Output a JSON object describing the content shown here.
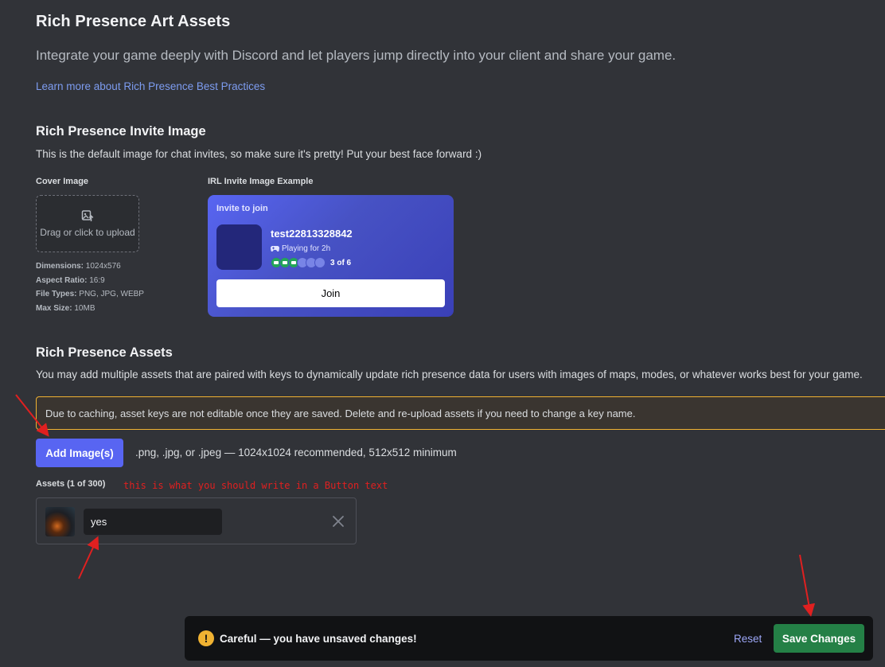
{
  "header": {
    "title": "Rich Presence Art Assets",
    "subtitle": "Integrate your game deeply with Discord and let players jump directly into your client and share your game.",
    "learn_link": "Learn more about Rich Presence Best Practices"
  },
  "invite_image": {
    "heading": "Rich Presence Invite Image",
    "description": "This is the default image for chat invites, so make sure it's pretty! Put your best face forward :)",
    "cover_label": "Cover Image",
    "upload_text": "Drag or click to upload",
    "specs": {
      "dimensions_label": "Dimensions:",
      "dimensions_value": "1024x576",
      "aspect_label": "Aspect Ratio:",
      "aspect_value": "16:9",
      "types_label": "File Types:",
      "types_value": "PNG, JPG, WEBP",
      "size_label": "Max Size:",
      "size_value": "10MB"
    },
    "example_label": "IRL Invite Image Example",
    "example": {
      "header": "Invite to join",
      "username": "test22813328842",
      "playing": "Playing for 2h",
      "party_filled": 3,
      "party_total": 6,
      "party_count_text": "3 of 6",
      "join_label": "Join"
    }
  },
  "assets": {
    "heading": "Rich Presence Assets",
    "description": "You may add multiple assets that are paired with keys to dynamically update rich presence data for users with images of maps, modes, or whatever works best for your game.",
    "warning": "Due to caching, asset keys are not editable once they are saved. Delete and re-upload assets if you need to change a key name.",
    "add_button": "Add Image(s)",
    "add_hint": ".png, .jpg, or .jpeg — 1024x1024 recommended, 512x512 minimum",
    "count_label": "Assets (1 of 300)",
    "annotation": "this is what you should write in a Button text",
    "items": [
      {
        "key": "yes"
      }
    ]
  },
  "unsaved_bar": {
    "icon": "!",
    "message": "Careful — you have unsaved changes!",
    "reset_label": "Reset",
    "save_label": "Save Changes"
  },
  "colors": {
    "background": "#313338",
    "blurple": "#5865f2",
    "save_green": "#248046",
    "warning_yellow": "#f0b232",
    "annotation_red": "#e02020"
  }
}
